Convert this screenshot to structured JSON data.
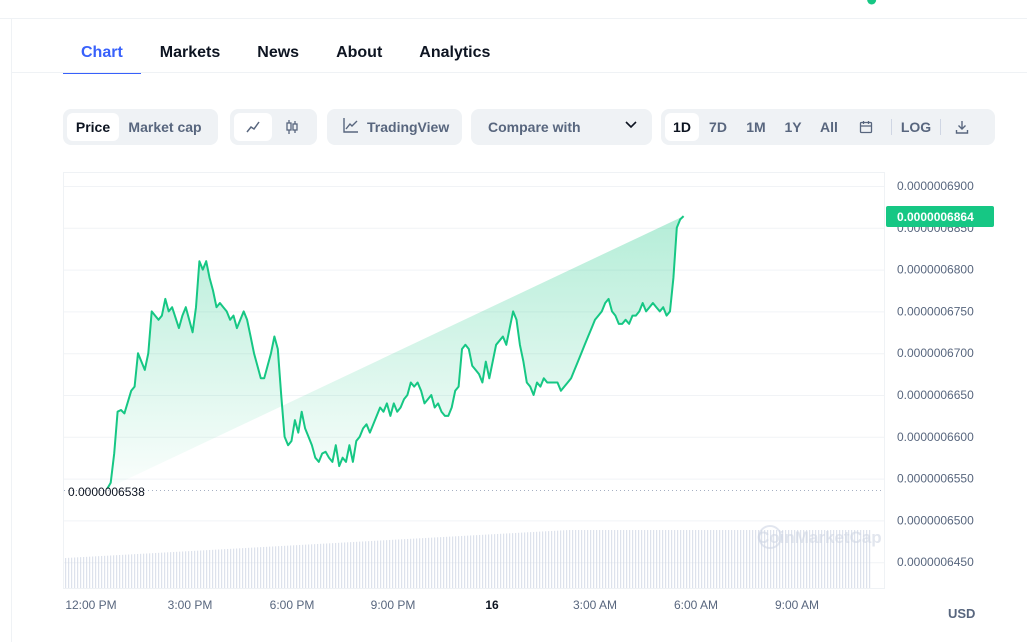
{
  "tabs": [
    {
      "label": "Chart",
      "active": true
    },
    {
      "label": "Markets",
      "active": false
    },
    {
      "label": "News",
      "active": false
    },
    {
      "label": "About",
      "active": false
    },
    {
      "label": "Analytics",
      "active": false
    }
  ],
  "toolbar": {
    "price_label": "Price",
    "market_cap_label": "Market cap",
    "chart_type_line_icon": "line-chart-icon",
    "chart_type_candle_icon": "candlestick-icon",
    "tradingview_label": "TradingView",
    "compare_label": "Compare with",
    "ranges": [
      "1D",
      "7D",
      "1M",
      "1Y",
      "All"
    ],
    "active_range": "1D",
    "calendar_icon": "calendar-icon",
    "log_label": "LOG",
    "download_icon": "download-icon"
  },
  "chart_data": {
    "type": "area",
    "y_tick_labels": [
      "0.0000006900",
      "0.0000006850",
      "0.0000006800",
      "0.0000006750",
      "0.0000006700",
      "0.0000006650",
      "0.0000006600",
      "0.0000006550",
      "0.0000006500",
      "0.0000006450"
    ],
    "ylim": [
      6.43e-07,
      6.92e-07
    ],
    "x_tick_labels": [
      "12:00 PM",
      "3:00 PM",
      "6:00 PM",
      "9:00 PM",
      "16",
      "3:00 AM",
      "6:00 AM",
      "9:00 AM"
    ],
    "current_price_label": "0.0000006864",
    "open_price_label": "0.0000006538",
    "watermark": "CoinMarketCap",
    "currency": "USD",
    "line_color": "#16c784",
    "series": [
      {
        "x_hours_from_noon": [
          1.3,
          1.4,
          1.5,
          1.6,
          1.7,
          1.8,
          2.0,
          2.1,
          2.2,
          2.4,
          2.5,
          2.6,
          2.7,
          2.8,
          2.9,
          3.0,
          3.1,
          3.2,
          3.4,
          3.5,
          3.6,
          3.7,
          3.8,
          3.9,
          4.0,
          4.1,
          4.2,
          4.3,
          4.4,
          4.5,
          4.6,
          4.7,
          4.8,
          4.9,
          5.0,
          5.1,
          5.2,
          5.3,
          5.4,
          5.5,
          5.6,
          5.8,
          5.9,
          6.0,
          6.1,
          6.2,
          6.3,
          6.4,
          6.5,
          6.6,
          6.7,
          6.8,
          6.9,
          7.0,
          7.1,
          7.2,
          7.3,
          7.4,
          7.5,
          7.6,
          7.7,
          7.8,
          7.9,
          8.0,
          8.1,
          8.2,
          8.3,
          8.4,
          8.5,
          8.6,
          8.7,
          8.8,
          8.9,
          9.0,
          9.1,
          9.2,
          9.3,
          9.4,
          9.5,
          9.6,
          9.7,
          9.8,
          9.9,
          10.0,
          10.1,
          10.2,
          10.3,
          10.4,
          10.5,
          10.6,
          10.7,
          10.8,
          10.9,
          11.0,
          11.1,
          11.2,
          11.3,
          11.4,
          11.5,
          11.6,
          11.7,
          11.8,
          11.9,
          12.0,
          12.1,
          12.2,
          12.3,
          12.4,
          12.5,
          12.6,
          12.7,
          12.8,
          12.9,
          13.0,
          13.1,
          13.2,
          13.3,
          13.4,
          13.5,
          13.6,
          13.7,
          13.8,
          13.9,
          14.0,
          14.1,
          14.2,
          14.3,
          14.4,
          14.5,
          14.6,
          14.7,
          14.8,
          14.9,
          15.0,
          15.1,
          15.2,
          15.3,
          15.4,
          15.5,
          15.6,
          15.7,
          15.8,
          15.9,
          16.0,
          16.1,
          16.2,
          16.3,
          16.4,
          16.5,
          16.6,
          16.7,
          16.8,
          16.9,
          17.0,
          17.1,
          17.2,
          17.3,
          17.4,
          17.5,
          17.6,
          17.7,
          17.8,
          17.9,
          18.0,
          18.1,
          18.2,
          18.3,
          18.4,
          18.5,
          18.6,
          18.7,
          18.8,
          18.9,
          19.0,
          19.1,
          19.2,
          19.3,
          19.4,
          19.5,
          19.6,
          19.7,
          19.8,
          19.9,
          20.0,
          20.1,
          20.2,
          20.3,
          20.4,
          20.5,
          20.6,
          20.7,
          20.8,
          20.9,
          21.0,
          21.1,
          21.2,
          21.3,
          21.4,
          21.5,
          21.6,
          21.7,
          21.8,
          21.9,
          22.0,
          22.1,
          22.2,
          22.3,
          22.4,
          22.5,
          22.6,
          22.7,
          22.8,
          22.9,
          23.0,
          23.1,
          23.2,
          23.3,
          23.4,
          23.5,
          23.6,
          23.7
        ],
        "y_price_e10": [
          6538,
          6545,
          6580,
          6630,
          6632,
          6628,
          6655,
          6660,
          6700,
          6680,
          6700,
          6750,
          6745,
          6740,
          6745,
          6765,
          6750,
          6755,
          6730,
          6745,
          6755,
          6740,
          6725,
          6755,
          6810,
          6800,
          6810,
          6790,
          6775,
          6755,
          6760,
          6755,
          6750,
          6740,
          6745,
          6730,
          6740,
          6750,
          6740,
          6720,
          6700,
          6670,
          6670,
          6685,
          6700,
          6720,
          6705,
          6650,
          6600,
          6590,
          6595,
          6620,
          6605,
          6630,
          6610,
          6600,
          6590,
          6575,
          6570,
          6580,
          6582,
          6575,
          6570,
          6590,
          6565,
          6575,
          6570,
          6590,
          6570,
          6595,
          6600,
          6610,
          6615,
          6605,
          6615,
          6625,
          6635,
          6630,
          6640,
          6625,
          6640,
          6630,
          6635,
          6645,
          6650,
          6665,
          6660,
          6665,
          6655,
          6640,
          6645,
          6650,
          6635,
          6640,
          6630,
          6625,
          6625,
          6635,
          6655,
          6660,
          6705,
          6710,
          6705,
          6685,
          6680,
          6675,
          6665,
          6690,
          6670,
          6690,
          6710,
          6715,
          6720,
          6710,
          6730,
          6750,
          6740,
          6710,
          6690,
          6665,
          6660,
          6650,
          6665,
          6660,
          6670,
          6665,
          6665,
          6665,
          6665,
          6655,
          6660,
          6665,
          6670,
          6680,
          6690,
          6700,
          6710,
          6720,
          6730,
          6740,
          6745,
          6750,
          6760,
          6765,
          6750,
          6745,
          6735,
          6735,
          6740,
          6735,
          6745,
          6745,
          6750,
          6760,
          6750,
          6755,
          6760,
          6755,
          6750,
          6755,
          6745,
          6750,
          6790,
          6850,
          6860,
          6864
        ]
      }
    ]
  }
}
